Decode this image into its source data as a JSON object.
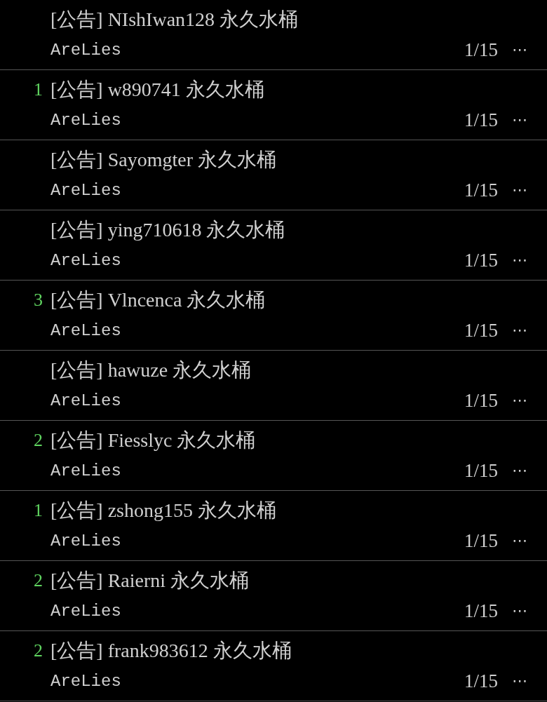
{
  "threads": [
    {
      "title": "[公告] NIshIwan128 永久水桶",
      "author": "AreLies",
      "pages": "1/15",
      "more": "⋯"
    },
    {
      "number": "1",
      "title": "[公告] w890741 永久水桶",
      "author": "AreLies",
      "pages": "1/15",
      "more": "⋯"
    },
    {
      "title": "[公告] Sayomgter 永久水桶",
      "author": "AreLies",
      "pages": "1/15",
      "more": "⋯"
    },
    {
      "title": "[公告] ying710618 永久水桶",
      "author": "AreLies",
      "pages": "1/15",
      "more": "⋯"
    },
    {
      "number": "3",
      "title": "[公告] Vlncenca 永久水桶",
      "author": "AreLies",
      "pages": "1/15",
      "more": "⋯"
    },
    {
      "title": "[公告] hawuze 永久水桶",
      "author": "AreLies",
      "pages": "1/15",
      "more": "⋯"
    },
    {
      "number": "2",
      "title": "[公告] Fiesslyc 永久水桶",
      "author": "AreLies",
      "pages": "1/15",
      "more": "⋯"
    },
    {
      "number": "1",
      "title": "[公告] zshong155 永久水桶",
      "author": "AreLies",
      "pages": "1/15",
      "more": "⋯"
    },
    {
      "number": "2",
      "title": "[公告] Raierni 永久水桶",
      "author": "AreLies",
      "pages": "1/15",
      "more": "⋯"
    },
    {
      "number": "2",
      "title": "[公告] frank983612 永久水桶",
      "author": "AreLies",
      "pages": "1/15",
      "more": "⋯"
    }
  ]
}
